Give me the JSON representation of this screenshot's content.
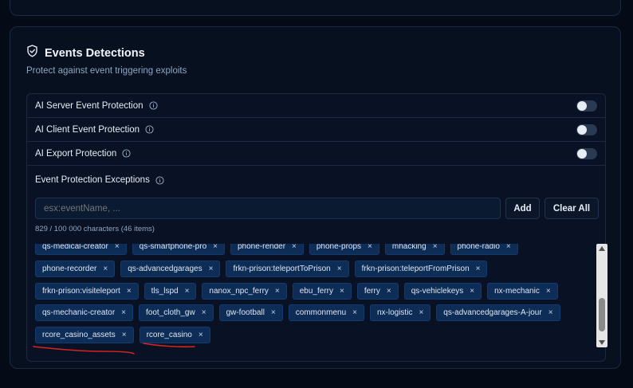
{
  "section": {
    "title": "Events Detections",
    "subtitle": "Protect against event triggering exploits"
  },
  "settings": [
    {
      "label": "AI Server Event Protection",
      "enabled": false
    },
    {
      "label": "AI Client Event Protection",
      "enabled": false
    },
    {
      "label": "AI Export Protection",
      "enabled": false
    }
  ],
  "exceptions": {
    "label": "Event Protection Exceptions",
    "input_placeholder": "esx:eventName, ...",
    "add_label": "Add",
    "clear_label": "Clear All",
    "counter": "829 / 100 000 characters (46 items)",
    "remove_glyph": "×",
    "tag_rows": [
      [
        "qs-medical-creator",
        "qs-smartphone-pro",
        "phone-render",
        "phone-props",
        "mhacking",
        "phone-radio"
      ],
      [
        "phone-recorder",
        "qs-advancedgarages",
        "frkn-prison:teleportToPrison",
        "frkn-prison:teleportFromPrison"
      ],
      [
        "frkn-prison:visiteleport",
        "tls_lspd",
        "nanox_npc_ferry",
        "ebu_ferry",
        "ferry",
        "qs-vehiclekeys",
        "nx-mechanic"
      ],
      [
        "qs-mechanic-creator",
        "foot_cloth_gw",
        "gw-football",
        "commonmenu",
        "nx-logistic",
        "qs-advancedgarages-A-jour"
      ],
      [
        "rcore_casino_assets",
        "rcore_casino"
      ]
    ]
  },
  "colors": {
    "background": "#050b16",
    "card": "#07101f",
    "tag": "#0d2c56",
    "annotation_underline": "#d8231f"
  },
  "icons": {
    "section": "shield-check-icon",
    "info": "info-icon",
    "scroll_up": "triangle-up-icon",
    "scroll_down": "triangle-down-icon"
  }
}
